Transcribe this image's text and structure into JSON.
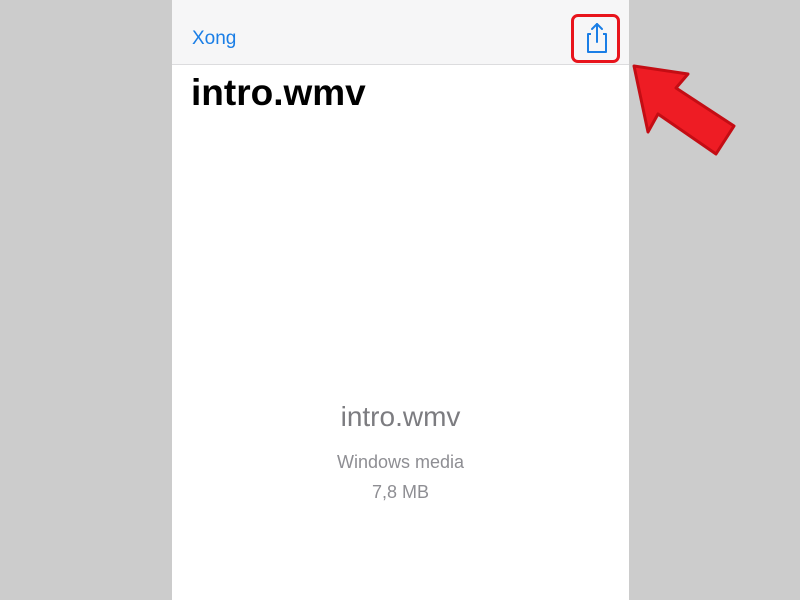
{
  "navbar": {
    "done_label": "Xong",
    "share_icon": "share-icon"
  },
  "page": {
    "title": "intro.wmv"
  },
  "file": {
    "name": "intro.wmv",
    "type": "Windows media",
    "size": "7,8 MB"
  },
  "colors": {
    "accent": "#1a7ee6",
    "highlight": "#e8141c",
    "backdrop": "#cccccc"
  }
}
